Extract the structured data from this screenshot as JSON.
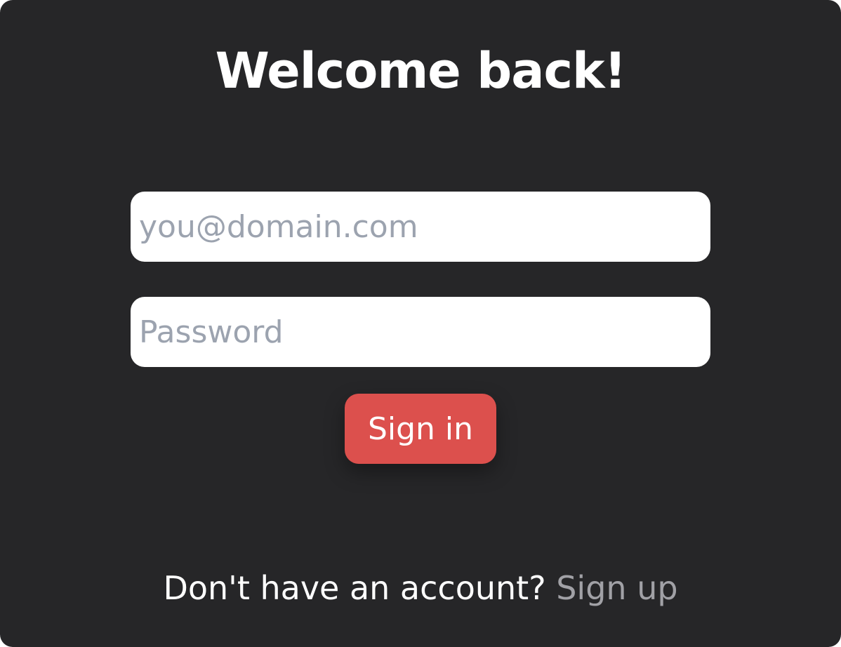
{
  "title": "Welcome back!",
  "email_field": {
    "placeholder": "you@domain.com",
    "value": ""
  },
  "password_field": {
    "placeholder": "Password",
    "value": ""
  },
  "signin_button": {
    "label": "Sign in"
  },
  "footer": {
    "prompt": "Don't have an account?",
    "link_label": "Sign up"
  },
  "colors": {
    "card_background": "#262628",
    "button": "#dc504d",
    "link": "#a1a1a6",
    "placeholder": "#9ca3af"
  }
}
